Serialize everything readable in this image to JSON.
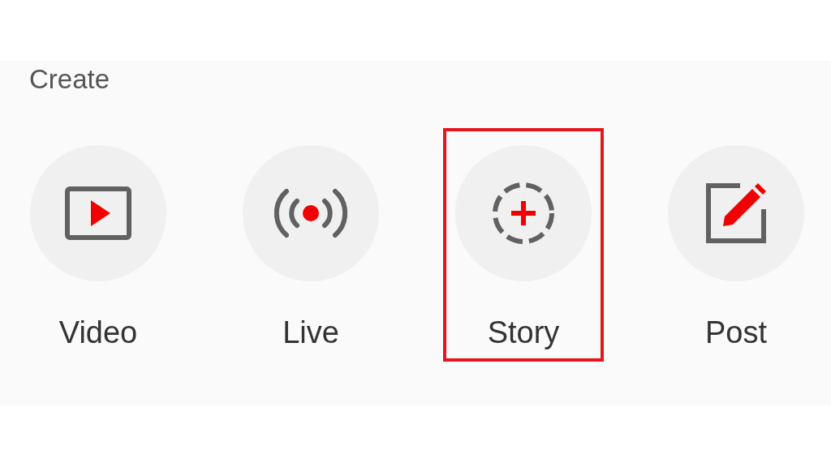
{
  "section": {
    "title": "Create"
  },
  "items": [
    {
      "kind": "video",
      "label": "Video",
      "highlighted": false
    },
    {
      "kind": "live",
      "label": "Live",
      "highlighted": false
    },
    {
      "kind": "story",
      "label": "Story",
      "highlighted": true
    },
    {
      "kind": "post",
      "label": "Post",
      "highlighted": false
    }
  ]
}
